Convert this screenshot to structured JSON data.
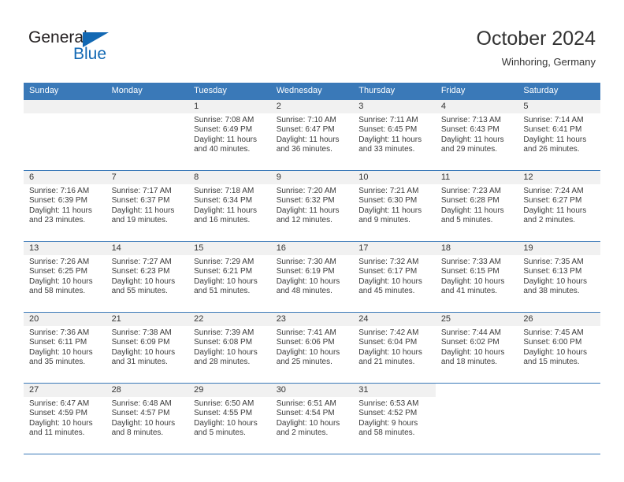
{
  "brand": {
    "name_part1": "General",
    "name_part2": "Blue",
    "triangle_icon": "triangle-logo-icon",
    "accent_color": "#1268b3"
  },
  "header": {
    "title": "October 2024",
    "subtitle": "Winhoring, Germany"
  },
  "theme": {
    "header_row_bg": "#3a79b8",
    "daynum_band_bg": "#f1f1f1",
    "row_border": "#3a79b8",
    "text": "#3b3b3b"
  },
  "weekdays": [
    "Sunday",
    "Monday",
    "Tuesday",
    "Wednesday",
    "Thursday",
    "Friday",
    "Saturday"
  ],
  "weeks": [
    [
      {
        "day": "",
        "lines": []
      },
      {
        "day": "",
        "lines": []
      },
      {
        "day": "1",
        "lines": [
          "Sunrise: 7:08 AM",
          "Sunset: 6:49 PM",
          "Daylight: 11 hours",
          "and 40 minutes."
        ]
      },
      {
        "day": "2",
        "lines": [
          "Sunrise: 7:10 AM",
          "Sunset: 6:47 PM",
          "Daylight: 11 hours",
          "and 36 minutes."
        ]
      },
      {
        "day": "3",
        "lines": [
          "Sunrise: 7:11 AM",
          "Sunset: 6:45 PM",
          "Daylight: 11 hours",
          "and 33 minutes."
        ]
      },
      {
        "day": "4",
        "lines": [
          "Sunrise: 7:13 AM",
          "Sunset: 6:43 PM",
          "Daylight: 11 hours",
          "and 29 minutes."
        ]
      },
      {
        "day": "5",
        "lines": [
          "Sunrise: 7:14 AM",
          "Sunset: 6:41 PM",
          "Daylight: 11 hours",
          "and 26 minutes."
        ]
      }
    ],
    [
      {
        "day": "6",
        "lines": [
          "Sunrise: 7:16 AM",
          "Sunset: 6:39 PM",
          "Daylight: 11 hours",
          "and 23 minutes."
        ]
      },
      {
        "day": "7",
        "lines": [
          "Sunrise: 7:17 AM",
          "Sunset: 6:37 PM",
          "Daylight: 11 hours",
          "and 19 minutes."
        ]
      },
      {
        "day": "8",
        "lines": [
          "Sunrise: 7:18 AM",
          "Sunset: 6:34 PM",
          "Daylight: 11 hours",
          "and 16 minutes."
        ]
      },
      {
        "day": "9",
        "lines": [
          "Sunrise: 7:20 AM",
          "Sunset: 6:32 PM",
          "Daylight: 11 hours",
          "and 12 minutes."
        ]
      },
      {
        "day": "10",
        "lines": [
          "Sunrise: 7:21 AM",
          "Sunset: 6:30 PM",
          "Daylight: 11 hours",
          "and 9 minutes."
        ]
      },
      {
        "day": "11",
        "lines": [
          "Sunrise: 7:23 AM",
          "Sunset: 6:28 PM",
          "Daylight: 11 hours",
          "and 5 minutes."
        ]
      },
      {
        "day": "12",
        "lines": [
          "Sunrise: 7:24 AM",
          "Sunset: 6:27 PM",
          "Daylight: 11 hours",
          "and 2 minutes."
        ]
      }
    ],
    [
      {
        "day": "13",
        "lines": [
          "Sunrise: 7:26 AM",
          "Sunset: 6:25 PM",
          "Daylight: 10 hours",
          "and 58 minutes."
        ]
      },
      {
        "day": "14",
        "lines": [
          "Sunrise: 7:27 AM",
          "Sunset: 6:23 PM",
          "Daylight: 10 hours",
          "and 55 minutes."
        ]
      },
      {
        "day": "15",
        "lines": [
          "Sunrise: 7:29 AM",
          "Sunset: 6:21 PM",
          "Daylight: 10 hours",
          "and 51 minutes."
        ]
      },
      {
        "day": "16",
        "lines": [
          "Sunrise: 7:30 AM",
          "Sunset: 6:19 PM",
          "Daylight: 10 hours",
          "and 48 minutes."
        ]
      },
      {
        "day": "17",
        "lines": [
          "Sunrise: 7:32 AM",
          "Sunset: 6:17 PM",
          "Daylight: 10 hours",
          "and 45 minutes."
        ]
      },
      {
        "day": "18",
        "lines": [
          "Sunrise: 7:33 AM",
          "Sunset: 6:15 PM",
          "Daylight: 10 hours",
          "and 41 minutes."
        ]
      },
      {
        "day": "19",
        "lines": [
          "Sunrise: 7:35 AM",
          "Sunset: 6:13 PM",
          "Daylight: 10 hours",
          "and 38 minutes."
        ]
      }
    ],
    [
      {
        "day": "20",
        "lines": [
          "Sunrise: 7:36 AM",
          "Sunset: 6:11 PM",
          "Daylight: 10 hours",
          "and 35 minutes."
        ]
      },
      {
        "day": "21",
        "lines": [
          "Sunrise: 7:38 AM",
          "Sunset: 6:09 PM",
          "Daylight: 10 hours",
          "and 31 minutes."
        ]
      },
      {
        "day": "22",
        "lines": [
          "Sunrise: 7:39 AM",
          "Sunset: 6:08 PM",
          "Daylight: 10 hours",
          "and 28 minutes."
        ]
      },
      {
        "day": "23",
        "lines": [
          "Sunrise: 7:41 AM",
          "Sunset: 6:06 PM",
          "Daylight: 10 hours",
          "and 25 minutes."
        ]
      },
      {
        "day": "24",
        "lines": [
          "Sunrise: 7:42 AM",
          "Sunset: 6:04 PM",
          "Daylight: 10 hours",
          "and 21 minutes."
        ]
      },
      {
        "day": "25",
        "lines": [
          "Sunrise: 7:44 AM",
          "Sunset: 6:02 PM",
          "Daylight: 10 hours",
          "and 18 minutes."
        ]
      },
      {
        "day": "26",
        "lines": [
          "Sunrise: 7:45 AM",
          "Sunset: 6:00 PM",
          "Daylight: 10 hours",
          "and 15 minutes."
        ]
      }
    ],
    [
      {
        "day": "27",
        "lines": [
          "Sunrise: 6:47 AM",
          "Sunset: 4:59 PM",
          "Daylight: 10 hours",
          "and 11 minutes."
        ]
      },
      {
        "day": "28",
        "lines": [
          "Sunrise: 6:48 AM",
          "Sunset: 4:57 PM",
          "Daylight: 10 hours",
          "and 8 minutes."
        ]
      },
      {
        "day": "29",
        "lines": [
          "Sunrise: 6:50 AM",
          "Sunset: 4:55 PM",
          "Daylight: 10 hours",
          "and 5 minutes."
        ]
      },
      {
        "day": "30",
        "lines": [
          "Sunrise: 6:51 AM",
          "Sunset: 4:54 PM",
          "Daylight: 10 hours",
          "and 2 minutes."
        ]
      },
      {
        "day": "31",
        "lines": [
          "Sunrise: 6:53 AM",
          "Sunset: 4:52 PM",
          "Daylight: 9 hours",
          "and 58 minutes."
        ]
      },
      {
        "day": "",
        "lines": []
      },
      {
        "day": "",
        "lines": []
      }
    ]
  ]
}
